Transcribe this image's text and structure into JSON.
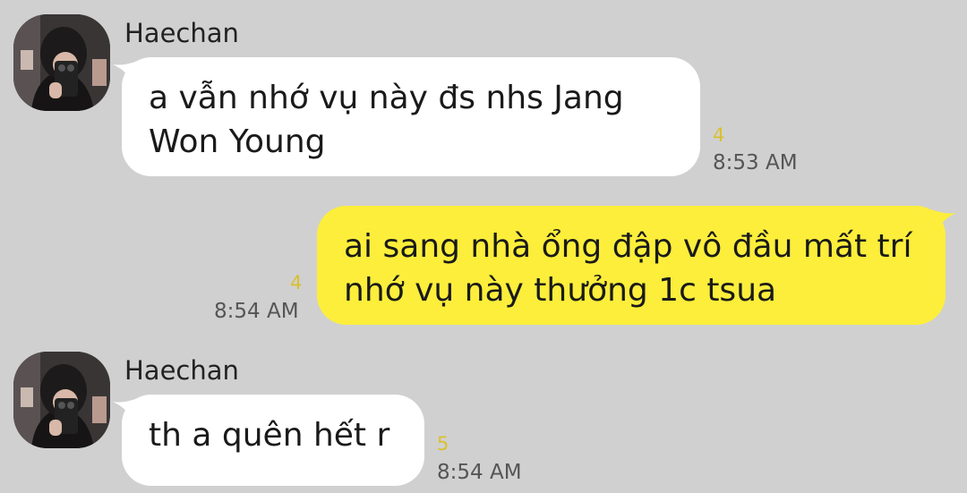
{
  "messages": [
    {
      "direction": "incoming",
      "sender": "Haechan",
      "avatar_icon": "profile-photo-avatar",
      "text": "a vẫn nhớ vụ này đs nhs Jang Won Young",
      "unread_count": "4",
      "time": "8:53 AM"
    },
    {
      "direction": "outgoing",
      "text": "ai sang nhà ổng đập vô đầu mất trí nhớ vụ này thưởng 1c tsua",
      "unread_count": "4",
      "time": "8:54 AM"
    },
    {
      "direction": "incoming",
      "sender": "Haechan",
      "avatar_icon": "profile-photo-avatar",
      "text": "th a quên hết r",
      "unread_count": "5",
      "time": "8:54 AM"
    }
  ],
  "colors": {
    "background": "#d0d0d0",
    "incoming_bubble": "#ffffff",
    "outgoing_bubble": "#fcee3b",
    "unread_count": "#d9c02e",
    "timestamp": "#555555"
  }
}
